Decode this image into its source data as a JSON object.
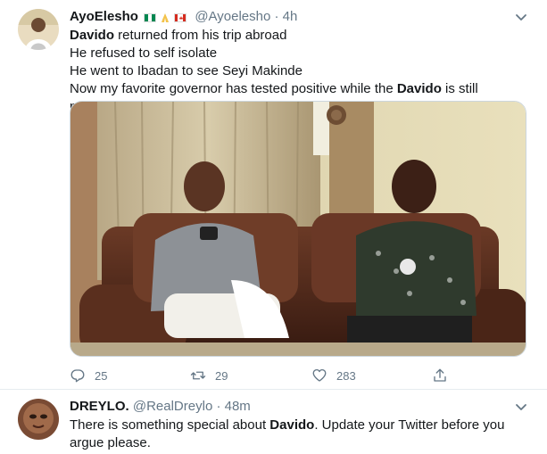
{
  "tweets": [
    {
      "display_name": "AyoElesho",
      "emoji_flags": [
        "nigeria-flag",
        "folded-hands",
        "canada-flag"
      ],
      "handle": "@Ayoelesho",
      "separator": "·",
      "time": "4h",
      "lines": [
        {
          "parts": [
            {
              "bold": "Davido"
            },
            {
              "text": " returned from his trip abroad"
            }
          ]
        },
        {
          "parts": [
            {
              "text": "He refused to self isolate"
            }
          ]
        },
        {
          "parts": [
            {
              "text": "He went to Ibadan to see Seyi Makinde"
            }
          ]
        },
        {
          "parts": [
            {
              "text": "Now my favorite governor has tested positive while the "
            },
            {
              "bold": "Davido"
            },
            {
              "text": " is still negative."
            }
          ]
        }
      ],
      "actions": {
        "replies": "25",
        "retweets": "29",
        "likes": "283"
      }
    },
    {
      "display_name": "DREYLO.",
      "handle": "@RealDreylo",
      "separator": "·",
      "time": "48m",
      "text_before": "There is something special about ",
      "text_bold": "Davido",
      "text_after": ". Update your Twitter before you argue please."
    }
  ],
  "icons": {
    "reply": "reply-icon",
    "retweet": "retweet-icon",
    "like": "heart-icon",
    "share": "share-icon",
    "caret": "chevron-down-icon"
  },
  "colors": {
    "text": "#14171a",
    "muted": "#657786",
    "border": "#e6ecf0"
  }
}
